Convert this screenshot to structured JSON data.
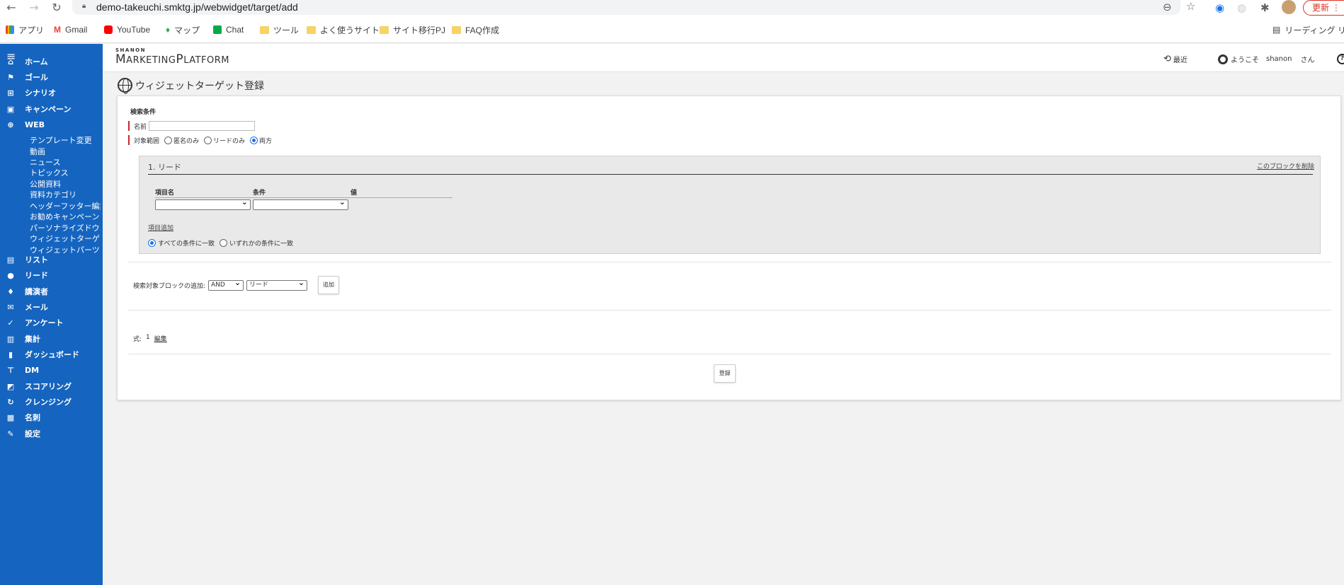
{
  "browser": {
    "url": "demo-takeuchi.smktg.jp/webwidget/target/add",
    "update_label": "更新",
    "reading_list_label": "リーディング リスト",
    "bookmarks": [
      {
        "label": "アプリ",
        "icon": "apps-icon"
      },
      {
        "label": "Gmail",
        "icon": "gmail-icon"
      },
      {
        "label": "YouTube",
        "icon": "youtube-icon"
      },
      {
        "label": "マップ",
        "icon": "maps-icon"
      },
      {
        "label": "Chat",
        "icon": "chat-icon"
      },
      {
        "label": "ツール",
        "icon": "folder-icon"
      },
      {
        "label": "よく使うサイト",
        "icon": "folder-icon"
      },
      {
        "label": "サイト移行PJ",
        "icon": "folder-icon"
      },
      {
        "label": "FAQ作成",
        "icon": "folder-icon"
      }
    ]
  },
  "sidebar": {
    "items": [
      {
        "label": "ホーム",
        "icon": "home-icon",
        "glyph": "⌂"
      },
      {
        "label": "ゴール",
        "icon": "flag-icon",
        "glyph": "⚑"
      },
      {
        "label": "シナリオ",
        "icon": "scenario-icon",
        "glyph": "⊞"
      },
      {
        "label": "キャンペーン",
        "icon": "campaign-icon",
        "glyph": "▣"
      },
      {
        "label": "WEB",
        "icon": "globe-icon",
        "glyph": "⊕"
      }
    ],
    "sub_items": [
      "テンプレート変更",
      "動画",
      "ニュース",
      "トピックス",
      "公開資料",
      "資料カテゴリ",
      "ヘッダーフッター編集",
      "お勧めキャンペーン",
      "パーソナライズドウ…",
      "ウィジェットターゲ…",
      "ウィジェットパーツ"
    ],
    "items2": [
      {
        "label": "リスト",
        "icon": "list-icon",
        "glyph": "▤"
      },
      {
        "label": "リード",
        "icon": "person-icon",
        "glyph": "●"
      },
      {
        "label": "講演者",
        "icon": "mic-icon",
        "glyph": "♦"
      },
      {
        "label": "メール",
        "icon": "mail-icon",
        "glyph": "✉"
      },
      {
        "label": "アンケート",
        "icon": "check-icon",
        "glyph": "✓"
      },
      {
        "label": "集計",
        "icon": "tally-icon",
        "glyph": "▥"
      },
      {
        "label": "ダッシュボード",
        "icon": "bar-chart-icon",
        "glyph": "▮"
      },
      {
        "label": "DM",
        "icon": "dm-icon",
        "glyph": "⊤"
      },
      {
        "label": "スコアリング",
        "icon": "scoring-icon",
        "glyph": "◩"
      },
      {
        "label": "クレンジング",
        "icon": "cleansing-icon",
        "glyph": "↻"
      },
      {
        "label": "名刺",
        "icon": "card-icon",
        "glyph": "▩"
      },
      {
        "label": "設定",
        "icon": "wrench-icon",
        "glyph": "✎"
      }
    ]
  },
  "header": {
    "logo_small": "SHANON",
    "logo_big_1": "M",
    "logo_big_2": "ARKETING",
    "logo_big_3": "P",
    "logo_big_4": "LATFORM",
    "recent_label": "最近",
    "welcome_label": "ようこそ",
    "user_name": "shanon",
    "user_suffix": "さん",
    "help_glyph": "?"
  },
  "page": {
    "title": "ウィジェットターゲット登録",
    "search_conditions_label": "検索条件",
    "name_label": "名前",
    "name_value": "",
    "scope_label": "対象範囲",
    "scope_options": [
      "匿名のみ",
      "リードのみ",
      "両方"
    ],
    "scope_selected": 2,
    "block": {
      "title": "1. リード",
      "delete_label": "このブロックを削除",
      "col_item": "項目名",
      "col_condition": "条件",
      "col_value": "値",
      "add_item_label": "項目追加",
      "match_all_label": "すべての条件に一致",
      "match_any_label": "いずれかの条件に一致"
    },
    "add_block_label": "検索対象ブロックの追加:",
    "add_block_op": "AND",
    "add_block_type": "リード",
    "add_button": "追加",
    "formula_label": "式:",
    "formula_value": "1",
    "formula_edit": "編集",
    "register_button": "登録"
  }
}
